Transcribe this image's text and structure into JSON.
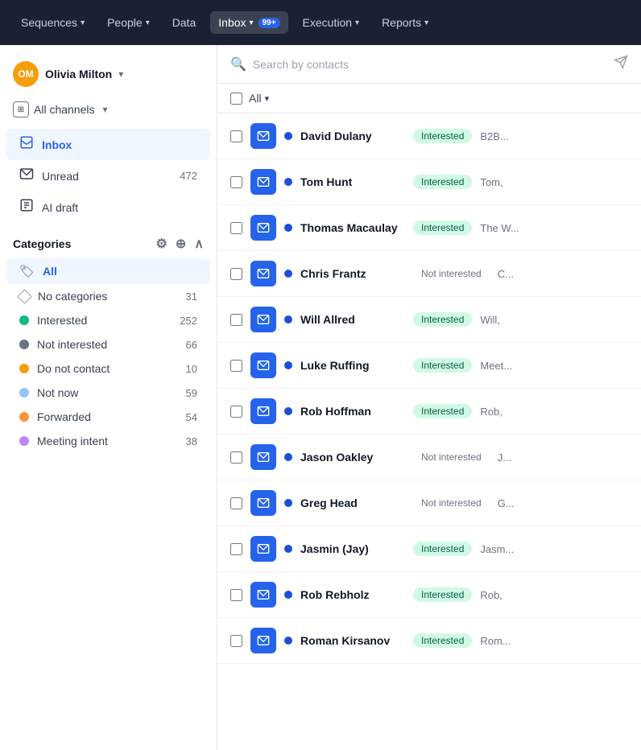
{
  "nav": {
    "items": [
      {
        "label": "Sequences",
        "hasDropdown": true,
        "active": false
      },
      {
        "label": "People",
        "hasDropdown": true,
        "active": false
      },
      {
        "label": "Data",
        "hasDropdown": false,
        "active": false
      },
      {
        "label": "Inbox",
        "hasDropdown": true,
        "active": true,
        "badge": "99+"
      },
      {
        "label": "Execution",
        "hasDropdown": true,
        "active": false
      },
      {
        "label": "Reports",
        "hasDropdown": true,
        "active": false
      }
    ]
  },
  "sidebar": {
    "user": {
      "name": "Olivia Milton",
      "initials": "OM"
    },
    "channels": "All channels",
    "navItems": [
      {
        "label": "Inbox",
        "icon": "📥",
        "active": true,
        "count": null
      },
      {
        "label": "Unread",
        "icon": "✉️",
        "active": false,
        "count": "472"
      },
      {
        "label": "AI draft",
        "icon": "🤖",
        "active": false,
        "count": null
      }
    ],
    "categoriesTitle": "Categories",
    "categories": [
      {
        "label": "All",
        "color": "#9ca3af",
        "type": "tag",
        "active": true,
        "count": null
      },
      {
        "label": "No categories",
        "color": "none",
        "type": "diamond",
        "active": false,
        "count": "31"
      },
      {
        "label": "Interested",
        "color": "#10b981",
        "type": "dot",
        "active": false,
        "count": "252"
      },
      {
        "label": "Not interested",
        "color": "#6b7280",
        "type": "dot",
        "active": false,
        "count": "66"
      },
      {
        "label": "Do not contact",
        "color": "#f59e0b",
        "type": "dot",
        "active": false,
        "count": "10"
      },
      {
        "label": "Not now",
        "color": "#93c5fd",
        "type": "dot",
        "active": false,
        "count": "59"
      },
      {
        "label": "Forwarded",
        "color": "#fb923c",
        "type": "dot",
        "active": false,
        "count": "54"
      },
      {
        "label": "Meeting intent",
        "color": "#c084fc",
        "type": "dot",
        "active": false,
        "count": "38"
      }
    ]
  },
  "search": {
    "placeholder": "Search by contacts"
  },
  "contacts": [
    {
      "name": "David Dulany",
      "status": "Interested",
      "preview": "B2B..."
    },
    {
      "name": "Tom Hunt",
      "status": "Interested",
      "preview": "Tom,"
    },
    {
      "name": "Thomas Macaulay",
      "status": "Interested",
      "preview": "The W..."
    },
    {
      "name": "Chris Frantz",
      "status": "Not interested",
      "preview": "C..."
    },
    {
      "name": "Will Allred",
      "status": "Interested",
      "preview": "Will,"
    },
    {
      "name": "Luke Ruffing",
      "status": "Interested",
      "preview": "Meet..."
    },
    {
      "name": "Rob Hoffman",
      "status": "Interested",
      "preview": "Rob,"
    },
    {
      "name": "Jason Oakley",
      "status": "Not interested",
      "preview": "J..."
    },
    {
      "name": "Greg Head",
      "status": "Not interested",
      "preview": "G..."
    },
    {
      "name": "Jasmin (Jay)",
      "status": "Interested",
      "preview": "Jasm..."
    },
    {
      "name": "Rob Rebholz",
      "status": "Interested",
      "preview": "Rob,"
    },
    {
      "name": "Roman Kirsanov",
      "status": "Interested",
      "preview": "Rom..."
    }
  ]
}
